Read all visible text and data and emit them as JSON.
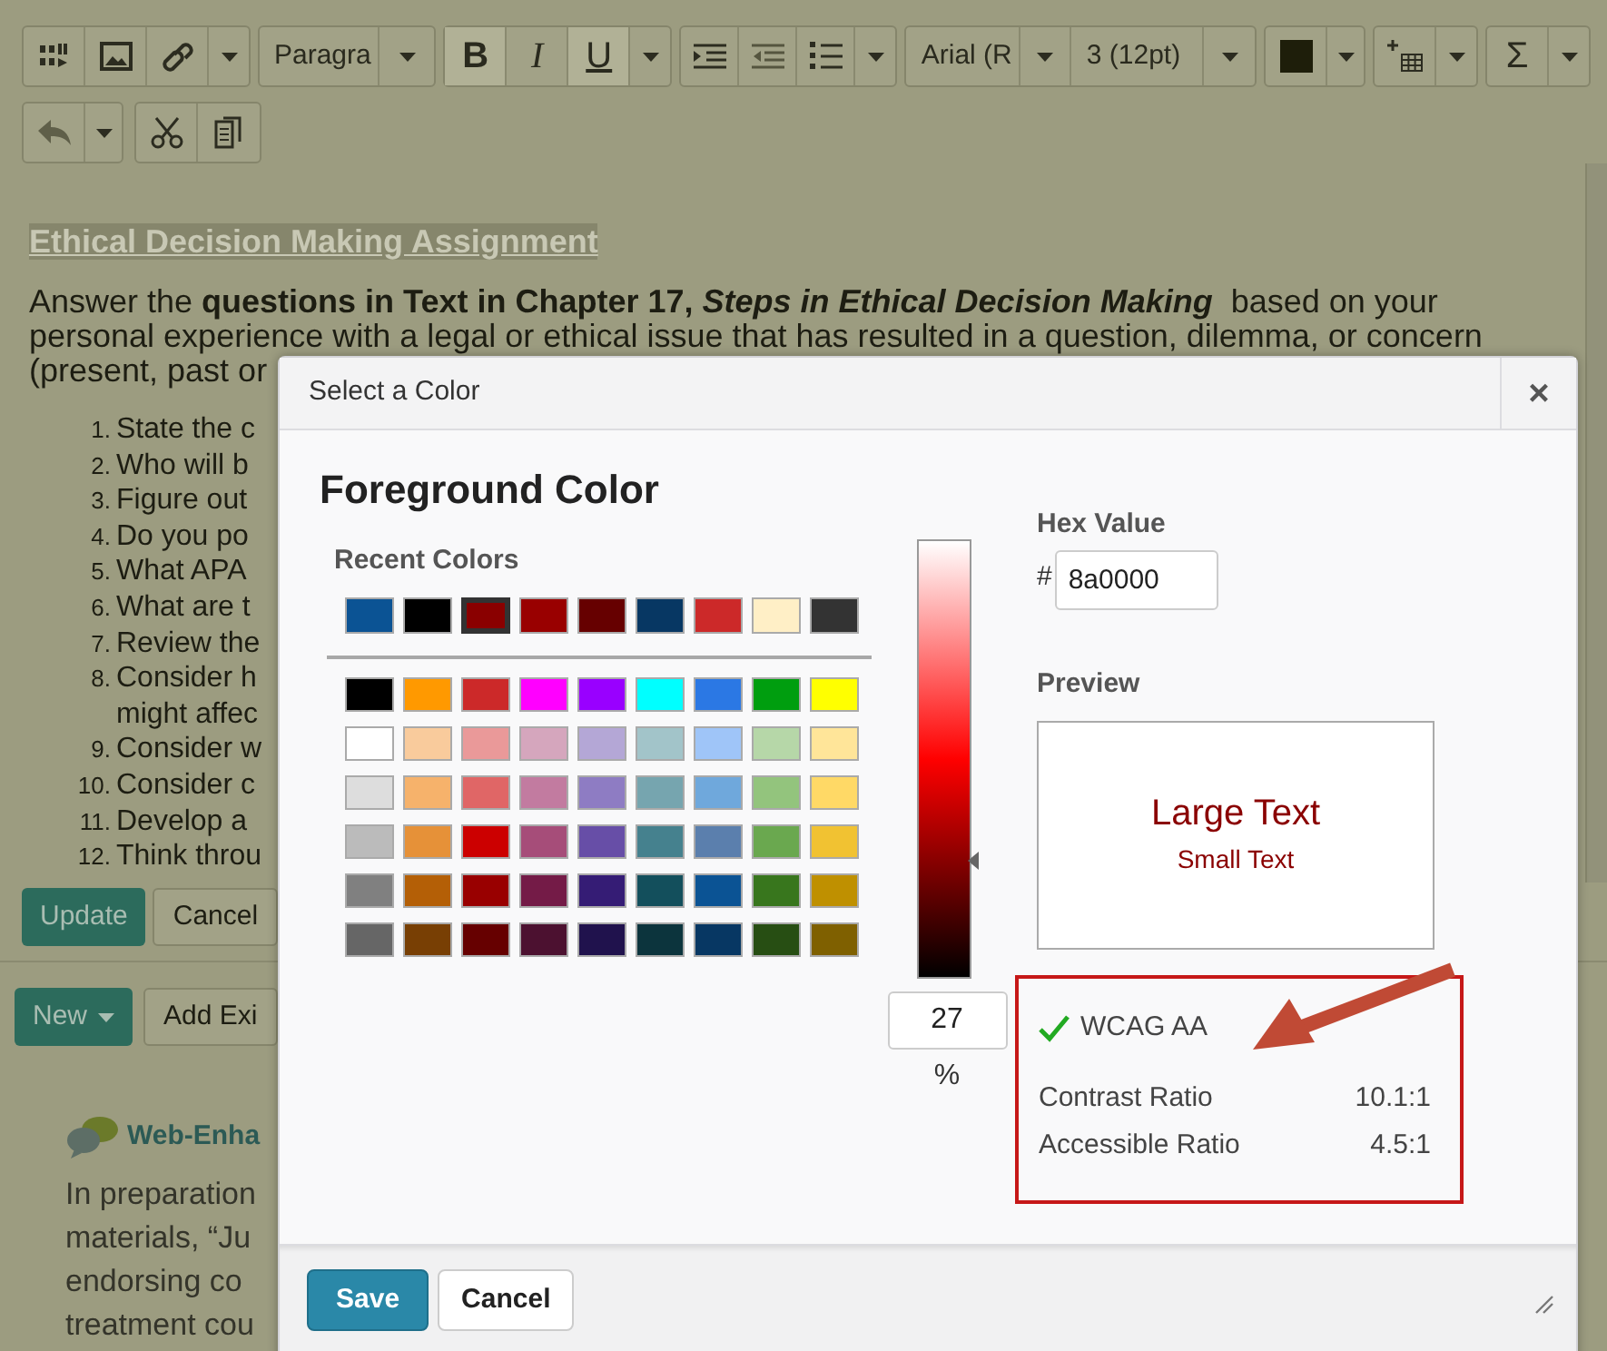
{
  "toolbar": {
    "paragraph_style": "Paragra",
    "formats": [
      {
        "label": "B",
        "kind": "bold",
        "selected": true
      },
      {
        "label": "I",
        "kind": "italic",
        "selected": false
      },
      {
        "label": "U",
        "kind": "underline",
        "selected": true
      }
    ],
    "font": "Arial (R",
    "size": "3 (12pt)",
    "sum": "Σ"
  },
  "document": {
    "heading": "Ethical Decision Making Assignment",
    "intro_lines": [
      [
        {
          "kind": "plain",
          "text": "Answer the "
        },
        {
          "kind": "bold",
          "text": "questions in Text in Chapter 17, "
        },
        {
          "kind": "bold_italic",
          "text": "Steps in Ethical Decision Making"
        },
        {
          "kind": "plain",
          "text": "  based on your"
        }
      ],
      [
        {
          "kind": "plain",
          "text": "personal experience with a legal or ethical issue that has resulted in a question, dilemma, or concern"
        }
      ],
      [
        {
          "kind": "plain",
          "text": "(present, past or"
        }
      ]
    ],
    "list": [
      {
        "number": "1.",
        "text": "State the c"
      },
      {
        "number": "2.",
        "text": "Who will b"
      },
      {
        "number": "3.",
        "text": "Figure out"
      },
      {
        "number": "4.",
        "text": "Do you po"
      },
      {
        "number": "5.",
        "text": "What APA"
      },
      {
        "number": "6.",
        "text": "What are t"
      },
      {
        "number": "7.",
        "text": "Review the"
      },
      {
        "number": "8.",
        "text": "Consider h",
        "continuation": "might affec"
      },
      {
        "number": "9.",
        "text": "Consider w"
      },
      {
        "number": "10.",
        "text": "Consider c"
      },
      {
        "number": "11.",
        "text": "Develop a"
      },
      {
        "number": "12.",
        "text": "Think throu"
      }
    ]
  },
  "editor_buttons": [
    "Update",
    "Cancel"
  ],
  "content_toolbar": {
    "new": "New",
    "add": "Add Exi"
  },
  "module": {
    "title": "Web-Enha",
    "lines": [
      "In preparation",
      "materials, “Ju",
      "endorsing co",
      "treatment cou"
    ]
  },
  "dialog": {
    "title": "Select a Color",
    "close": "×",
    "heading": "Foreground Color",
    "recent_label": "Recent Colors",
    "recent": [
      {
        "color": "#0b5394",
        "selected": false
      },
      {
        "color": "#000000",
        "selected": false
      },
      {
        "color": "#8a0000",
        "selected": true
      },
      {
        "color": "#990000",
        "selected": false
      },
      {
        "color": "#660000",
        "selected": false
      },
      {
        "color": "#073763",
        "selected": false
      },
      {
        "color": "#cc2929",
        "selected": false
      },
      {
        "color": "#ffefc6",
        "selected": false
      },
      {
        "color": "#333333",
        "selected": false
      }
    ],
    "palette": [
      {
        "swatches": [
          {
            "color": "#000000"
          },
          {
            "color": "#ff9900"
          },
          {
            "color": "#cc2929"
          },
          {
            "color": "#ff00ff"
          },
          {
            "color": "#9900ff"
          },
          {
            "color": "#00ffff"
          },
          {
            "color": "#2b78e4"
          },
          {
            "color": "#009e0f"
          },
          {
            "color": "#ffff00"
          }
        ]
      },
      {
        "swatches": [
          {
            "color": "#ffffff"
          },
          {
            "color": "#f9cb9c"
          },
          {
            "color": "#ea9999"
          },
          {
            "color": "#d5a6bd"
          },
          {
            "color": "#b4a7d6"
          },
          {
            "color": "#a2c4c9"
          },
          {
            "color": "#9fc5f8"
          },
          {
            "color": "#b6d7a8"
          },
          {
            "color": "#ffe599"
          }
        ]
      },
      {
        "swatches": [
          {
            "color": "#dddddd"
          },
          {
            "color": "#f6b26b"
          },
          {
            "color": "#e06666"
          },
          {
            "color": "#c27ba0"
          },
          {
            "color": "#8e7cc3"
          },
          {
            "color": "#76a5af"
          },
          {
            "color": "#6fa8dc"
          },
          {
            "color": "#93c47d"
          },
          {
            "color": "#ffd966"
          }
        ]
      },
      {
        "swatches": [
          {
            "color": "#bbbbbb"
          },
          {
            "color": "#e69138"
          },
          {
            "color": "#cc0000"
          },
          {
            "color": "#a64d79"
          },
          {
            "color": "#674ea7"
          },
          {
            "color": "#45818e"
          },
          {
            "color": "#5b7fad"
          },
          {
            "color": "#6aa84f"
          },
          {
            "color": "#f1c232"
          }
        ]
      },
      {
        "swatches": [
          {
            "color": "#808080"
          },
          {
            "color": "#b45f06"
          },
          {
            "color": "#990000"
          },
          {
            "color": "#741b47"
          },
          {
            "color": "#351c75"
          },
          {
            "color": "#134f5c"
          },
          {
            "color": "#0b5394"
          },
          {
            "color": "#38761d"
          },
          {
            "color": "#bf9000"
          }
        ]
      },
      {
        "swatches": [
          {
            "color": "#666666"
          },
          {
            "color": "#783f04"
          },
          {
            "color": "#660000"
          },
          {
            "color": "#4c1130"
          },
          {
            "color": "#20124d"
          },
          {
            "color": "#0c343d"
          },
          {
            "color": "#073763"
          },
          {
            "color": "#274e13"
          },
          {
            "color": "#7f6000"
          }
        ]
      }
    ],
    "shade": {
      "level": 0.27,
      "reading": "27",
      "unit": "%"
    },
    "hex": {
      "label": "Hex Value",
      "prefix": "#",
      "value": "8a0000"
    },
    "preview": {
      "label": "Preview",
      "large": "Large Text",
      "small": "Small Text",
      "color": "#8a0000"
    },
    "wcag": {
      "passed": true,
      "label": "WCAG AA",
      "rows": [
        {
          "label": "Contrast Ratio",
          "value": "10.1:1"
        },
        {
          "label": "Accessible Ratio",
          "value": "4.5:1"
        }
      ]
    },
    "buttons": {
      "save": "Save",
      "cancel": "Cancel"
    }
  }
}
